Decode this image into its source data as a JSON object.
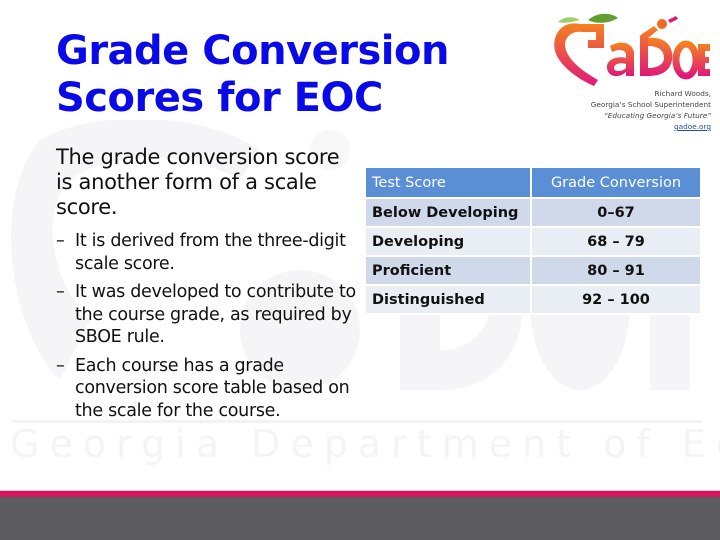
{
  "slide": {
    "title_lines": [
      "Grade Conversion",
      "Scores for EOC"
    ],
    "logo": {
      "brand_text": "GaDOE",
      "caption": {
        "name": "Richard Woods,",
        "role": "Georgia’s School Superintendent",
        "tagline": "“Educating Georgia’s Future”",
        "link": "gadoe.org"
      }
    },
    "body": {
      "lead": "The grade conversion score is another form of a scale score.",
      "bullet_marker": "–",
      "bullets": [
        "It is derived from the three-digit scale score.",
        "It was developed to contribute to the course grade, as required by SBOE rule.",
        "Each course has a grade conversion score table based on the scale for the course."
      ]
    },
    "table": {
      "headers": [
        "Test Score",
        "Grade Conversion"
      ],
      "rows": [
        [
          "Below Developing",
          "0–67"
        ],
        [
          "Developing",
          "68 – 79"
        ],
        [
          "Proficient",
          "80 – 91"
        ],
        [
          "Distinguished",
          "92 – 100"
        ]
      ]
    },
    "watermark": {
      "logo_text": "GaDOE",
      "text": "Georgia Department of Education"
    },
    "colors": {
      "title": "#0a0ae8",
      "table_header": "#5a8fd6",
      "row_dark": "#d0d9ea",
      "row_light": "#e9edf4",
      "footer_stripe": "#d4145f",
      "footer_bar": "#5d5c5e",
      "logo_orange": "#f26a21",
      "logo_magenta": "#e0187a",
      "logo_green": "#6aa62e"
    }
  }
}
